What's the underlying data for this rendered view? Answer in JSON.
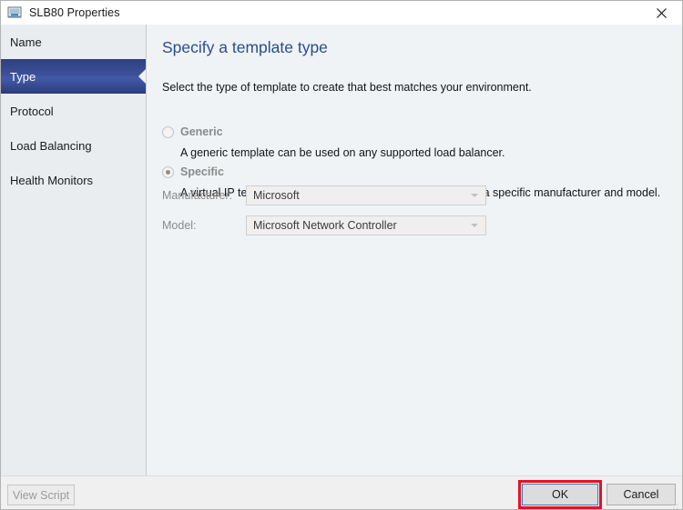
{
  "window": {
    "title": "SLB80 Properties",
    "icon": "load-balancer-icon",
    "close_icon": "close-icon"
  },
  "sidebar": {
    "items": [
      {
        "label": "Name",
        "selected": false
      },
      {
        "label": "Type",
        "selected": true
      },
      {
        "label": "Protocol",
        "selected": false
      },
      {
        "label": "Load Balancing",
        "selected": false
      },
      {
        "label": "Health Monitors",
        "selected": false
      }
    ]
  },
  "main": {
    "heading": "Specify a template type",
    "subtitle": "Select the type of template to create that best matches your environment.",
    "options": [
      {
        "label": "Generic",
        "description": "A generic template can be used on any supported load balancer.",
        "selected": false,
        "enabled": false
      },
      {
        "label": "Specific",
        "description": "A virtual IP template can be used only on a load balancer of a specific manufacturer and model.",
        "selected": true,
        "enabled": false
      }
    ],
    "fields": [
      {
        "label": "Manufacturer:",
        "value": "Microsoft",
        "enabled": false,
        "arrow_icon": "chevron-down-icon"
      },
      {
        "label": "Model:",
        "value": "Microsoft Network Controller",
        "enabled": false,
        "arrow_icon": "chevron-down-icon"
      }
    ]
  },
  "footer": {
    "view_script_label": "View Script",
    "ok_label": "OK",
    "cancel_label": "Cancel"
  },
  "annotation": {
    "highlight_color": "#e81123",
    "target": "ok-button"
  },
  "colors": {
    "selected_nav": "#3c5099",
    "heading": "#2a4d8f",
    "content_bg": "#eff3f6",
    "sidebar_bg": "#e9edf0",
    "focus_border": "#2a7fd4"
  }
}
